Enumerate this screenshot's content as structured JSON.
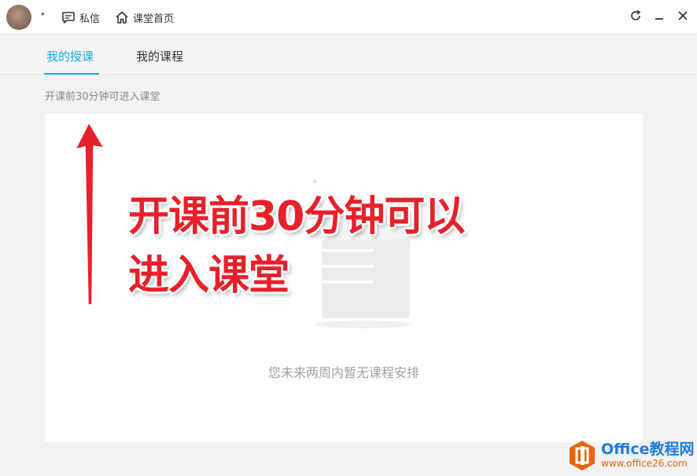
{
  "titlebar": {
    "message_label": "私信",
    "home_label": "课堂首页"
  },
  "tabs": [
    {
      "label": "我的授课",
      "active": true
    },
    {
      "label": "我的课程",
      "active": false
    }
  ],
  "hint": "开课前30分钟可进入课堂",
  "empty_state": {
    "text": "您未来两周内暂无课程安排"
  },
  "annotation": {
    "line1": "开课前30分钟可以",
    "line2": "进入课堂",
    "color": "#e8202a"
  },
  "watermark": {
    "title": "Office教程网",
    "url": "www.office26.com"
  },
  "colors": {
    "accent": "#1aa8e8",
    "annotation_red": "#e8202a",
    "watermark_blue": "#1e7be0",
    "watermark_orange": "#e8650e"
  }
}
